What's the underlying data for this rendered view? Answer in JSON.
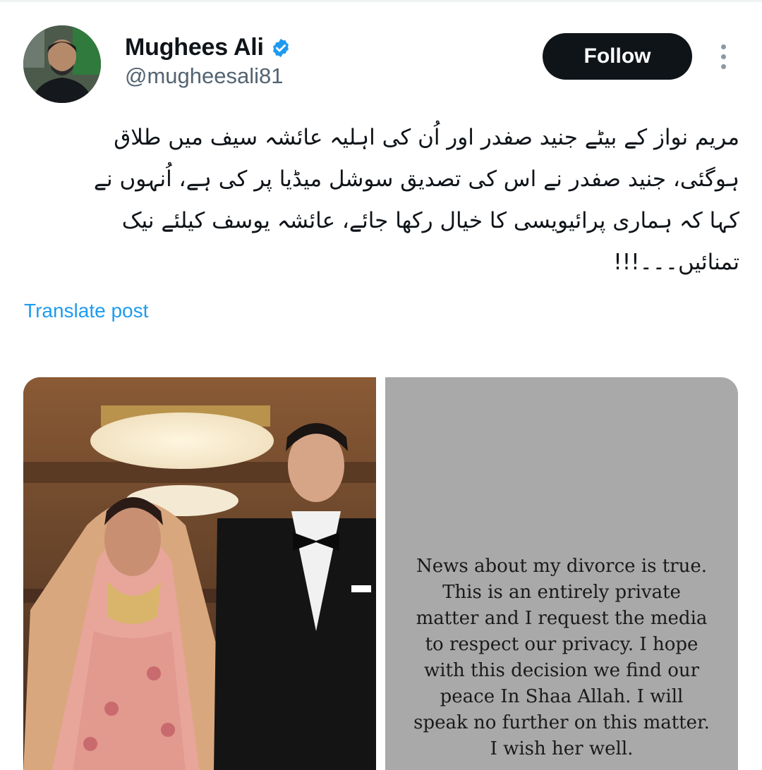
{
  "author": {
    "display_name": "Mughees Ali",
    "handle": "@mugheesali81",
    "verified": true,
    "avatar_icon": "profile-photo"
  },
  "actions": {
    "follow_label": "Follow",
    "more_icon": "more-vertical-icon"
  },
  "post": {
    "lines": [
      "مریم نواز کے بیٹے جنید صفدر اور اُن کی اہلیہ عائشہ سیف میں طلاق",
      "ہوگئی، جنید صفدر نے اس کی تصدیق سوشل میڈیا پر کی ہے، اُنہوں نے",
      "کہا کہ ہماری پرائیویسی کا خیال رکھا جائے، عائشہ یوسف کیلئے نیک",
      "تمنائیں۔۔۔!!!"
    ],
    "translate_label": "Translate post"
  },
  "media": {
    "left_image": "wedding-photo",
    "story_lines": [
      "News about my divorce is true.",
      "This is an entirely private",
      "matter and I request the media",
      "to respect our privacy. I hope",
      "with this decision we find our",
      "peace In Shaa Allah. I will",
      "speak no further on this matter.",
      "I wish her well."
    ]
  },
  "colors": {
    "accent": "#1d9bf0",
    "button_bg": "#0f1419",
    "secondary_text": "#536471",
    "story_bg": "#a9a9a9"
  }
}
